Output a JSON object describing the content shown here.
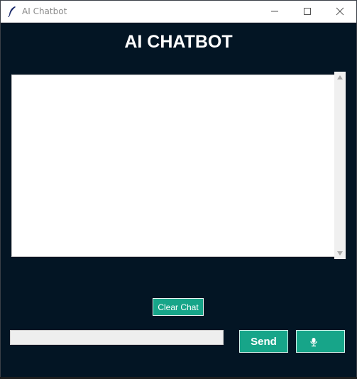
{
  "window": {
    "title": "AI Chatbot",
    "icon": "feather-icon",
    "controls": [
      "minimize-icon",
      "maximize-icon",
      "close-icon"
    ]
  },
  "header": {
    "title": "AI CHATBOT"
  },
  "chat": {
    "messages": []
  },
  "actions": {
    "clear_label": "Clear Chat",
    "send_label": "Send",
    "mic_icon": "microphone-icon"
  },
  "input": {
    "value": "",
    "placeholder": ""
  },
  "colors": {
    "background": "#031524",
    "accent": "#17a589",
    "chat_bg": "#ffffff",
    "input_bg": "#eeeeee"
  }
}
